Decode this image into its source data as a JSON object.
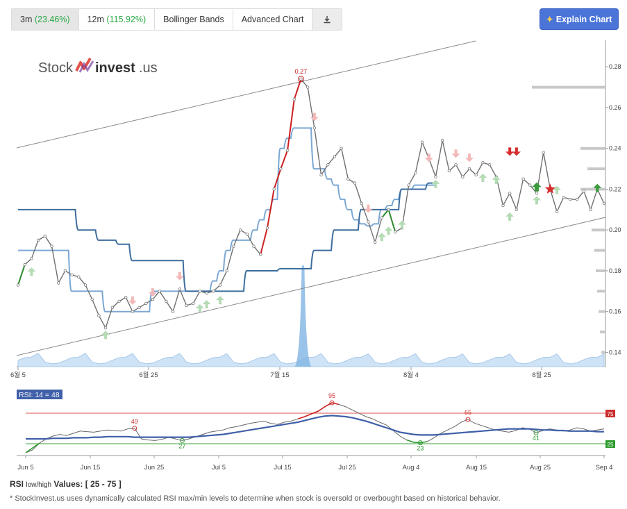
{
  "toolbar": {
    "tabs": [
      {
        "label": "3m",
        "change": "(23.46%)"
      },
      {
        "label": "12m",
        "change": "(115.92%)"
      },
      {
        "label": "Bollinger Bands"
      },
      {
        "label": "Advanced Chart"
      }
    ],
    "download_icon": "download-icon",
    "explain_label": "Explain Chart",
    "explain_icon": "sparkle-icon"
  },
  "logo": {
    "text_left": "Stock",
    "text_right": "invest",
    "text_suffix": ".us"
  },
  "colors": {
    "price": "#6f6f6f",
    "price_up_green": "#2e8b2e",
    "price_hot_red": "#cc1f1f",
    "bollinger": "#7ba7d4",
    "support_resistance": "#3d6d9e",
    "trend_channel": "#8a8a8a",
    "volume": "#b7d4ef",
    "rsi_line": "#666666",
    "rsi_ma": "#3f5fa8",
    "overbought": "#cc3333",
    "oversold": "#2e9b2e"
  },
  "chart_data": [
    {
      "type": "line",
      "name": "price",
      "y_ticks": [
        "0.14",
        "0.16",
        "0.18",
        "0.20",
        "0.22",
        "0.24",
        "0.26",
        "0.28"
      ],
      "x_ticks": [
        "6월 5",
        "6월 25",
        "7월 15",
        "8월 4",
        "8월 25"
      ],
      "ylim": [
        0.133,
        0.293
      ],
      "x_count": 63,
      "peak_label": "0.27",
      "values": [
        0.173,
        0.183,
        0.186,
        0.195,
        0.197,
        0.192,
        0.174,
        0.18,
        0.178,
        0.177,
        0.173,
        0.166,
        0.158,
        0.152,
        0.162,
        0.165,
        0.167,
        0.16,
        0.162,
        0.164,
        0.166,
        0.17,
        0.165,
        0.16,
        0.171,
        0.163,
        0.164,
        0.17,
        0.169,
        0.17,
        0.173,
        0.18,
        0.192,
        0.2,
        0.198,
        0.192,
        0.188,
        0.201,
        0.22,
        0.23,
        0.239,
        0.264,
        0.274,
        0.27,
        0.25,
        0.227,
        0.232,
        0.236,
        0.24,
        0.225,
        0.223,
        0.213,
        0.204,
        0.194,
        0.206,
        0.21,
        0.199,
        0.201,
        0.222,
        0.228,
        0.243,
        0.235,
        0.226
      ],
      "extra_tail": [
        0.244,
        0.229,
        0.232,
        0.226,
        0.23,
        0.227,
        0.233,
        0.232,
        0.226,
        0.212,
        0.218,
        0.21,
        0.225,
        0.222,
        0.218,
        0.238,
        0.22,
        0.209,
        0.216,
        0.215,
        0.215,
        0.219,
        0.21,
        0.22,
        0.213
      ],
      "bollinger_band": [
        0.19,
        0.19,
        0.19,
        0.19,
        0.19,
        0.19,
        0.19,
        0.19,
        0.17,
        0.17,
        0.17,
        0.17,
        0.17,
        0.16,
        0.16,
        0.16,
        0.16,
        0.16,
        0.16,
        0.16,
        0.17,
        0.17,
        0.17,
        0.17,
        0.17,
        0.17,
        0.17,
        0.17,
        0.17,
        0.175,
        0.18,
        0.19,
        0.195,
        0.195,
        0.195,
        0.2,
        0.205,
        0.21,
        0.215,
        0.24,
        0.245,
        0.25,
        0.25,
        0.25,
        0.23,
        0.23,
        0.225,
        0.222,
        0.215,
        0.21,
        0.205,
        0.203,
        0.202,
        0.203,
        0.21,
        0.212,
        0.215,
        0.22,
        0.22,
        0.222,
        0.222,
        0.222,
        0.222
      ],
      "support_resistance": [
        0.21,
        0.21,
        0.21,
        0.21,
        0.21,
        0.21,
        0.21,
        0.21,
        0.21,
        0.2,
        0.2,
        0.2,
        0.195,
        0.195,
        0.195,
        0.193,
        0.193,
        0.185,
        0.185,
        0.185,
        0.185,
        0.185,
        0.185,
        0.185,
        0.185,
        0.17,
        0.17,
        0.17,
        0.17,
        0.17,
        0.17,
        0.17,
        0.17,
        0.17,
        0.18,
        0.18,
        0.18,
        0.18,
        0.18,
        0.181,
        0.181,
        0.181,
        0.181,
        0.181,
        0.19,
        0.19,
        0.19,
        0.2,
        0.2,
        0.2,
        0.2,
        0.21,
        0.21,
        0.21,
        0.21,
        0.21,
        0.21,
        0.22,
        0.22,
        0.22,
        0.22,
        0.223,
        0.223
      ],
      "rsi_label": "RSI: 14 = 48",
      "rsi_x_ticks": [
        "Jun 5",
        "Jun 15",
        "Jun 25",
        "Jul 5",
        "Jul 15",
        "Jul 25",
        "Aug 4",
        "Aug 15",
        "Aug 25",
        "Sep 4"
      ],
      "rsi_levels": {
        "high": "75",
        "low": "25"
      },
      "rsi_annotations": [
        "49",
        "27",
        "95",
        "23",
        "65",
        "41"
      ]
    }
  ],
  "footer": {
    "rsi_title": "RSI",
    "rsi_sub": "low/high",
    "rsi_values": "Values: [ 25 - 75 ]",
    "note": "* StockInvest.us uses dynamically calculated RSI max/min levels to determine when stock is oversold or overbought based on historical behavior."
  }
}
